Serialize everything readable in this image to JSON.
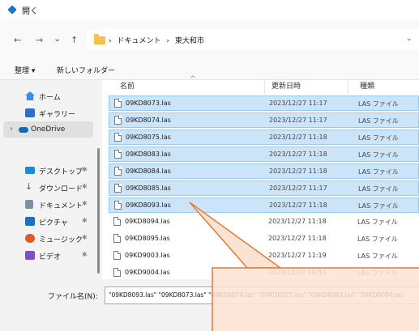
{
  "window": {
    "title": "開く"
  },
  "nav": {
    "back": "←",
    "forward": "→",
    "recent": "⌄",
    "up": "↑"
  },
  "address": {
    "crumbs": [
      "›",
      "ドキュメント",
      "›",
      "東大和市"
    ],
    "dropdown": "⌄"
  },
  "command_bar": {
    "organize": "整理 ▾",
    "new_folder": "新しいフォルダー"
  },
  "sidebar": {
    "items": [
      {
        "label": "ホーム",
        "icon": "home-icon",
        "pinned": false
      },
      {
        "label": "ギャラリー",
        "icon": "gallery-icon",
        "pinned": false
      },
      {
        "label": "OneDrive",
        "icon": "onedrive-icon",
        "pinned": false,
        "expander": "›"
      },
      {
        "label": "デスクトップ",
        "icon": "desktop-icon",
        "pinned": true
      },
      {
        "label": "ダウンロード",
        "icon": "download-icon",
        "pinned": true
      },
      {
        "label": "ドキュメント",
        "icon": "documents-icon",
        "pinned": true
      },
      {
        "label": "ピクチャ",
        "icon": "pictures-icon",
        "pinned": true
      },
      {
        "label": "ミュージック",
        "icon": "music-icon",
        "pinned": true
      },
      {
        "label": "ビデオ",
        "icon": "videos-icon",
        "pinned": true
      }
    ],
    "pin_glyph": "✱"
  },
  "columns": {
    "name": "名前",
    "date": "更新日時",
    "type": "種類",
    "sort_indicator": "^"
  },
  "files": [
    {
      "name": "09KD8073.las",
      "date": "2023/12/27 11:17",
      "type": "LAS ファイル",
      "selected": true
    },
    {
      "name": "09KD8074.las",
      "date": "2023/12/27 11:17",
      "type": "LAS ファイル",
      "selected": true
    },
    {
      "name": "09KD8075.las",
      "date": "2023/12/27 11:18",
      "type": "LAS ファイル",
      "selected": true
    },
    {
      "name": "09KD8083.las",
      "date": "2023/12/27 11:18",
      "type": "LAS ファイル",
      "selected": true
    },
    {
      "name": "09KD8084.las",
      "date": "2023/12/27 11:18",
      "type": "LAS ファイル",
      "selected": true
    },
    {
      "name": "09KD8085.las",
      "date": "2023/12/27 11:17",
      "type": "LAS ファイル",
      "selected": true
    },
    {
      "name": "09KD8093.las",
      "date": "2023/12/27 11:18",
      "type": "LAS ファイル",
      "selected": true
    },
    {
      "name": "09KD8094.las",
      "date": "2023/12/27 11:18",
      "type": "LAS ファイル",
      "selected": false
    },
    {
      "name": "09KD8095.las",
      "date": "2023/12/27 11:18",
      "type": "LAS ファイル",
      "selected": false
    },
    {
      "name": "09KD9003.las",
      "date": "2023/12/27 11:19",
      "type": "LAS ファイル",
      "selected": false
    },
    {
      "name": "09KD9004.las",
      "date": "2023/12/27 10:51",
      "type": "LAS ファイル",
      "selected": false
    }
  ],
  "filename_field": {
    "label": "ファイル名(N):",
    "value": "\"09KD8093.las\" \"09KD8073.las\" \"09KD8074.las\" \"09KD8075.las\" \"09KD8083.las\" \"09KD8084.las"
  },
  "colors": {
    "accent": "#1a73d6",
    "selection": "#cce4f7",
    "callout_fill": "#fbe3d4",
    "callout_stroke": "#e07b39"
  }
}
